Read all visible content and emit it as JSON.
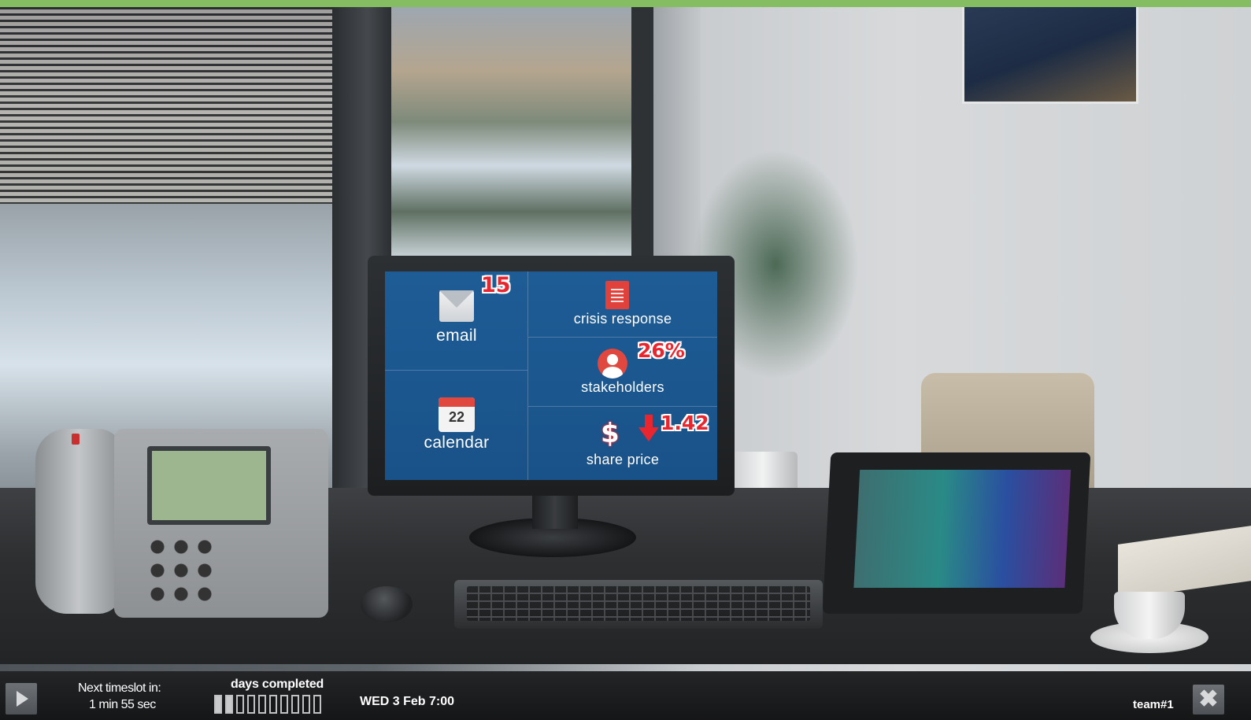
{
  "accent_color": "#85bd63",
  "screen_color": "#1e5c96",
  "badge_color": "#e8262f",
  "desktop": {
    "email": {
      "label": "email",
      "count": "15",
      "icon": "envelope-icon"
    },
    "crisis_response": {
      "label": "crisis response",
      "icon": "document-icon"
    },
    "stakeholders": {
      "label": "stakeholders",
      "percent": "26%",
      "icon": "person-icon"
    },
    "calendar": {
      "label": "calendar",
      "day": "22",
      "icon": "calendar-icon"
    },
    "share_price": {
      "label": "share price",
      "value": "1.42",
      "trend": "down",
      "symbol": "$",
      "icon": "dollar-icon"
    }
  },
  "bottombar": {
    "play_icon": "play-icon",
    "next_label": "Next timeslot in:",
    "next_value": "1 min 55 sec",
    "days_label": "days completed",
    "days_completed": 2,
    "days_total": 10,
    "datetime": "WED 3 Feb 7:00",
    "team": "team#1",
    "close_icon": "close-icon",
    "close_glyph": "✖"
  }
}
